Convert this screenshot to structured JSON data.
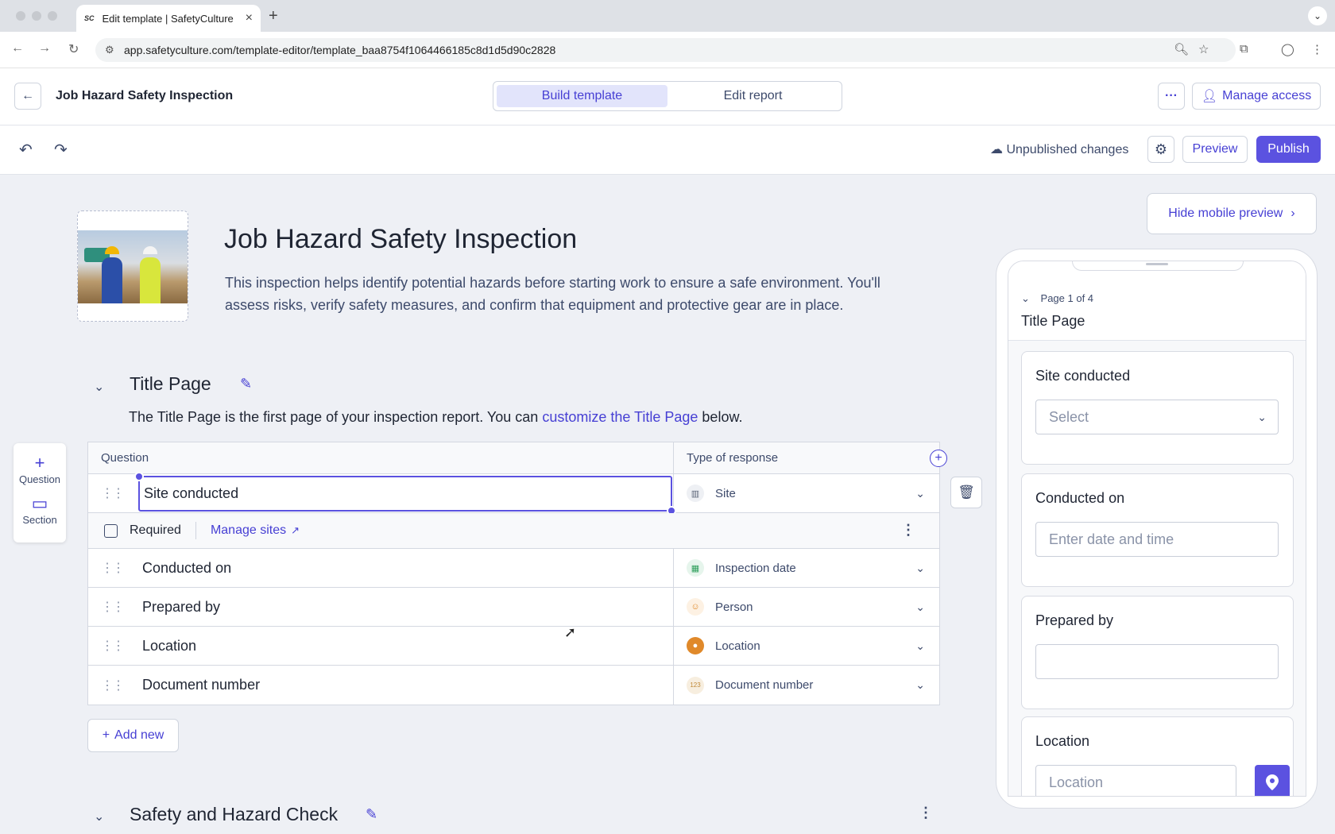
{
  "browser": {
    "tab_title": "Edit template | SafetyCulture",
    "tab_favicon": "SC",
    "url": "app.safetyculture.com/template-editor/template_baa8754f1064466185c8d1d5d90c2828"
  },
  "header": {
    "title": "Job Hazard Safety Inspection",
    "tabs": [
      "Build template",
      "Edit report"
    ],
    "active_tab": "Build template",
    "more_label": "···",
    "manage_access": "Manage access"
  },
  "toolbar": {
    "status": "Unpublished changes",
    "preview": "Preview",
    "publish": "Publish"
  },
  "template": {
    "title": "Job Hazard Safety Inspection",
    "description": "This inspection helps identify potential hazards before starting work to ensure a safe environment. You'll assess risks, verify safety measures, and confirm that equipment and protective gear are in place."
  },
  "title_page": {
    "heading": "Title Page",
    "note_before": "The Title Page is the first page of your inspection report. You can ",
    "note_link": "customize the Title Page",
    "note_after": " below.",
    "col_question": "Question",
    "col_response": "Type of response",
    "required_label": "Required",
    "manage_sites": "Manage sites",
    "rows": [
      {
        "question": "Site conducted",
        "response": "Site",
        "icon": "building-icon",
        "color": "#5b6478"
      },
      {
        "question": "Conducted on",
        "response": "Inspection date",
        "icon": "calendar-icon",
        "color": "#2e9e5b"
      },
      {
        "question": "Prepared by",
        "response": "Person",
        "icon": "person-icon",
        "color": "#e0892a"
      },
      {
        "question": "Location",
        "response": "Location",
        "icon": "location-pin-icon",
        "color": "#e0892a"
      },
      {
        "question": "Document number",
        "response": "Document number",
        "icon": "number-icon",
        "color": "#c08a3a"
      }
    ],
    "add_new": "Add new"
  },
  "next_section": {
    "heading": "Safety and Hazard Check"
  },
  "side_toolbar": {
    "question": "Question",
    "section": "Section"
  },
  "mobile_preview": {
    "hide_label": "Hide mobile preview",
    "page_indicator": "Page 1 of 4",
    "page_title": "Title Page",
    "cards": [
      {
        "label": "Site conducted",
        "placeholder": "Select"
      },
      {
        "label": "Conducted on",
        "placeholder": "Enter date and time"
      },
      {
        "label": "Prepared by",
        "placeholder": ""
      },
      {
        "label": "Location",
        "placeholder": "Location"
      }
    ]
  },
  "colors": {
    "accent": "#5b52e0",
    "accent_text": "#4740d4",
    "background": "#eef0f5"
  }
}
